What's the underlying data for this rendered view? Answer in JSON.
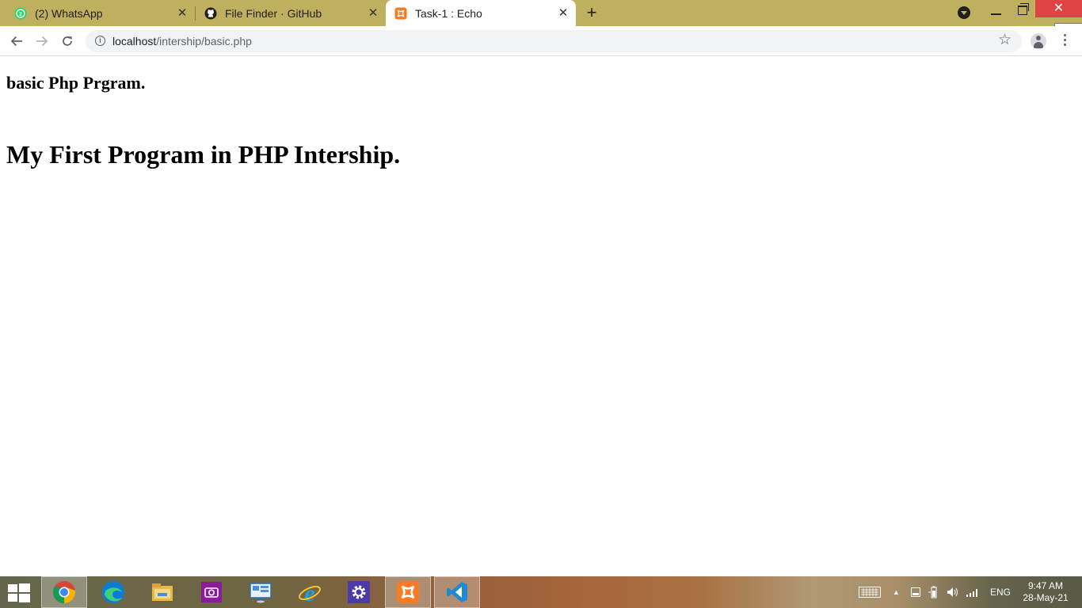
{
  "browser": {
    "tabs": [
      {
        "title": "(2) WhatsApp",
        "icon": "whatsapp-icon",
        "active": false
      },
      {
        "title": "File Finder · GitHub",
        "icon": "github-icon",
        "active": false
      },
      {
        "title": "Task-1 : Echo",
        "icon": "xampp-icon",
        "active": true
      }
    ],
    "close_tooltip": "Close",
    "url_host": "localhost",
    "url_path": "/intership/basic.php"
  },
  "page": {
    "heading_small": "basic Php Prgram.",
    "heading_large": "My First Program in PHP Intership."
  },
  "taskbar": {
    "apps": [
      {
        "name": "chrome-icon",
        "active": true
      },
      {
        "name": "edge-icon",
        "active": false
      },
      {
        "name": "file-explorer-icon",
        "active": false
      },
      {
        "name": "camera-app-icon",
        "active": false
      },
      {
        "name": "remote-desktop-icon",
        "active": false
      },
      {
        "name": "internet-explorer-icon",
        "active": false
      },
      {
        "name": "settings-icon",
        "active": false
      },
      {
        "name": "xampp-icon",
        "active": true
      },
      {
        "name": "vscode-icon",
        "active": true
      }
    ],
    "language": "ENG",
    "time": "9:47 AM",
    "date": "28-May-21"
  },
  "colors": {
    "tabbar": "#bfb05f",
    "close_button": "#e04343",
    "omnibox": "#f1f3f4"
  }
}
